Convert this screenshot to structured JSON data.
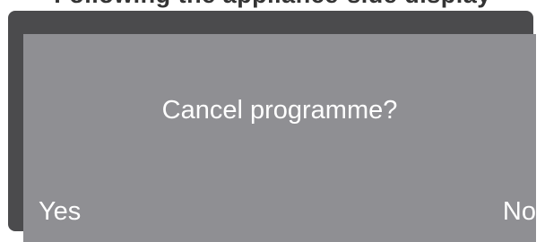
{
  "header": {
    "partial_text": "Following the appliance-side display"
  },
  "dialog": {
    "message": "Cancel programme?",
    "yes_label": "Yes",
    "no_label": "No"
  }
}
